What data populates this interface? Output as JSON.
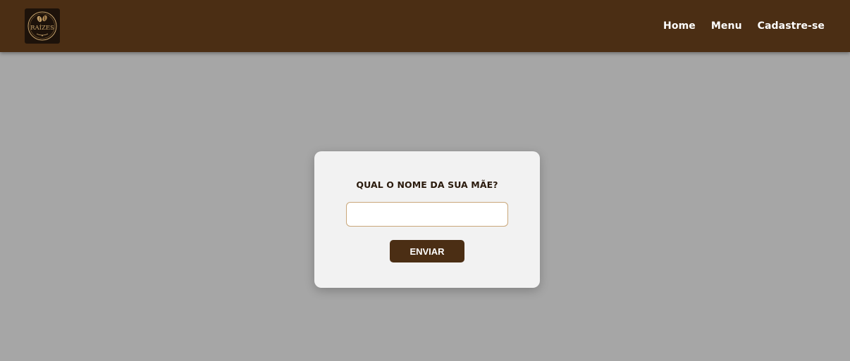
{
  "navbar": {
    "logo": {
      "text": "RAÍZES",
      "icon": "coffee-beans-logo-icon"
    },
    "links": [
      {
        "label": "Home"
      },
      {
        "label": "Menu"
      },
      {
        "label": "Cadastre-se"
      }
    ]
  },
  "form": {
    "question": "QUAL O NOME DA SUA MÃE?",
    "input_value": "",
    "input_placeholder": "",
    "submit_label": "ENVIAR"
  },
  "colors": {
    "navbar_bg": "#4b2e14",
    "page_bg": "#a6a6a6",
    "card_bg": "#f2f2f2",
    "input_border": "#c9a77a",
    "button_bg": "#4b2e14"
  }
}
